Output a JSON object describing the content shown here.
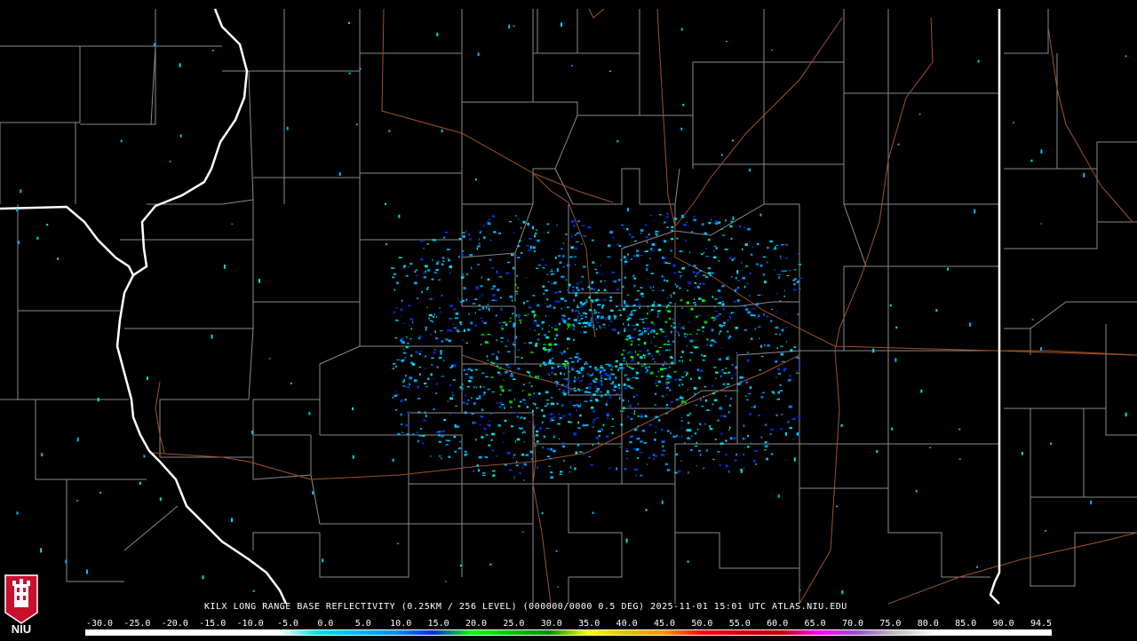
{
  "caption": "KILX LONG RANGE BASE REFLECTIVITY (0.25KM / 256 LEVEL) (000000/0000 0.5 DEG) 2025-11-01 15:01 UTC  ATLAS.NIU.EDU",
  "logo": {
    "text": "NIU",
    "color": "#c8102e"
  },
  "scale": {
    "labels": [
      "-30.0",
      "-25.0",
      "-20.0",
      "-15.0",
      "-10.0",
      "-5.0",
      "0.0",
      "5.0",
      "10.0",
      "15.0",
      "20.0",
      "25.0",
      "30.0",
      "35.0",
      "40.0",
      "45.0",
      "50.0",
      "55.0",
      "60.0",
      "65.0",
      "70.0",
      "75.0",
      "80.0",
      "85.0",
      "90.0",
      "94.5"
    ],
    "colors": [
      "#ffffff",
      "#ffffff",
      "#ffffff",
      "#ffffff",
      "#ffffff",
      "#ffffff",
      "#00e0e0",
      "#00b8f8",
      "#0090f0",
      "#0030d8",
      "#00ff00",
      "#00c800",
      "#009000",
      "#ffff00",
      "#e0c000",
      "#ff9000",
      "#ff0000",
      "#d00000",
      "#c00000",
      "#ff00ff",
      "#9955c9",
      "#c0c0c0",
      "#ffffff",
      "#ffffff",
      "#ffffff",
      "#ffffff"
    ]
  },
  "colors": {
    "state_border": "#ffffff",
    "county_border": "#8a8a8a",
    "highway": "#a0522d",
    "background": "#000000"
  }
}
